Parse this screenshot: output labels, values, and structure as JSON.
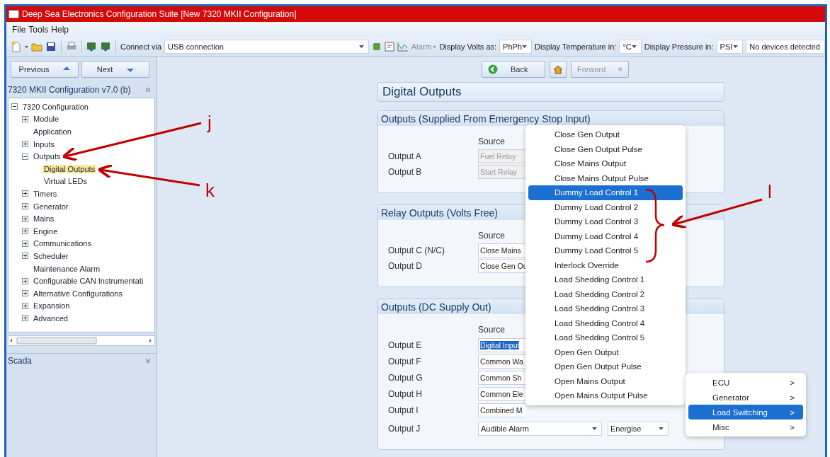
{
  "window": {
    "title": "Deep Sea Electronics Configuration Suite [New 7320 MKII Configuration]"
  },
  "menu_bar": [
    "File",
    "Tools",
    "Help"
  ],
  "toolbar": {
    "connect_label": "Connect via",
    "connection": "USB connection",
    "alarm": "Alarm",
    "volts_label": "Display Volts as:",
    "volts": "PhPh",
    "temperature_label": "Display Temperature in:",
    "temperature": "°C",
    "pressure_label": "Display Pressure in:",
    "pressure": "PSI",
    "status": "No devices detected"
  },
  "sidebar": {
    "previous": "Previous",
    "next": "Next",
    "tree_title": "7320 MKII Configuration v7.0 (b)",
    "scada": "Scada",
    "tree": [
      {
        "label": "7320 Configuration",
        "kind": "folder",
        "expanded": true,
        "selected": false,
        "children": [
          {
            "label": "Module",
            "kind": "folder",
            "expanded": false,
            "selected": false
          },
          {
            "label": "Application",
            "kind": "leaf",
            "selected": false
          },
          {
            "label": "Inputs",
            "kind": "folder",
            "expanded": false,
            "selected": false
          },
          {
            "label": "Outputs",
            "kind": "folder",
            "expanded": true,
            "selected": false,
            "children": [
              {
                "label": "Digital Outputs",
                "kind": "leaf",
                "selected": true
              },
              {
                "label": "Virtual LEDs",
                "kind": "leaf",
                "selected": false
              }
            ]
          },
          {
            "label": "Timers",
            "kind": "folder",
            "expanded": false,
            "selected": false
          },
          {
            "label": "Generator",
            "kind": "folder",
            "expanded": false,
            "selected": false
          },
          {
            "label": "Mains",
            "kind": "folder",
            "expanded": false,
            "selected": false
          },
          {
            "label": "Engine",
            "kind": "folder",
            "expanded": false,
            "selected": false
          },
          {
            "label": "Communications",
            "kind": "folder",
            "expanded": false,
            "selected": false
          },
          {
            "label": "Scheduler",
            "kind": "folder",
            "expanded": false,
            "selected": false
          },
          {
            "label": "Maintenance Alarm",
            "kind": "leaf",
            "selected": false
          },
          {
            "label": "Configurable CAN Instrumentati",
            "kind": "folder",
            "expanded": false,
            "selected": false
          },
          {
            "label": "Alternative Configurations",
            "kind": "folder",
            "expanded": false,
            "selected": false
          },
          {
            "label": "Expansion",
            "kind": "folder",
            "expanded": false,
            "selected": false
          },
          {
            "label": "Advanced",
            "kind": "folder",
            "expanded": false,
            "selected": false
          }
        ]
      }
    ]
  },
  "nav": {
    "back": "Back",
    "forward": "Forward",
    "forward_disabled": true
  },
  "page": {
    "title": "Digital Outputs",
    "sections": [
      {
        "title": "Outputs (Supplied From Emergency Stop Input)",
        "column": "Source",
        "rows": [
          {
            "label": "Output A",
            "source": "Fuel Relay",
            "disabled": true,
            "highlighted": false
          },
          {
            "label": "Output B",
            "source": "Start Relay",
            "disabled": true,
            "highlighted": false
          }
        ]
      },
      {
        "title": "Relay Outputs (Volts Free)",
        "column": "Source",
        "rows": [
          {
            "label": "Output C (N/C)",
            "source": "Close Mains",
            "disabled": false,
            "highlighted": false
          },
          {
            "label": "Output D",
            "source": "Close Gen Ou",
            "disabled": false,
            "highlighted": false
          }
        ]
      },
      {
        "title": "Outputs (DC Supply Out)",
        "column": "Source",
        "rows": [
          {
            "label": "Output E",
            "source": "Digital Input",
            "disabled": false,
            "highlighted": true
          },
          {
            "label": "Output F",
            "source": "Common Wa",
            "disabled": false,
            "highlighted": false
          },
          {
            "label": "Output G",
            "source": "Common Sh",
            "disabled": false,
            "highlighted": false
          },
          {
            "label": "Output H",
            "source": "Common Ele",
            "disabled": false,
            "highlighted": false
          },
          {
            "label": "Output I",
            "source": "Combined M",
            "disabled": false,
            "highlighted": false
          },
          {
            "label": "Output J",
            "source": "Audible Alarm",
            "polarity": "Energise",
            "disabled": false,
            "highlighted": false
          }
        ]
      }
    ]
  },
  "popup_menu": [
    {
      "label": "Close Gen Output",
      "selected": false
    },
    {
      "label": "Close Gen Output Pulse",
      "selected": false
    },
    {
      "label": "Close Mains Output",
      "selected": false
    },
    {
      "label": "Close Mains Output Pulse",
      "selected": false
    },
    {
      "label": "Dummy Load Control 1",
      "selected": true
    },
    {
      "label": "Dummy Load Control 2",
      "selected": false
    },
    {
      "label": "Dummy Load Control 3",
      "selected": false
    },
    {
      "label": "Dummy Load Control 4",
      "selected": false
    },
    {
      "label": "Dummy Load Control 5",
      "selected": false
    },
    {
      "label": "Interlock Override",
      "selected": false
    },
    {
      "label": "Load Shedding Control 1",
      "selected": false
    },
    {
      "label": "Load Shedding Control 2",
      "selected": false
    },
    {
      "label": "Load Shedding Control 3",
      "selected": false
    },
    {
      "label": "Load Shedding Control 4",
      "selected": false
    },
    {
      "label": "Load Shedding Control 5",
      "selected": false
    },
    {
      "label": "Open Gen Output",
      "selected": false
    },
    {
      "label": "Open Gen Output Pulse",
      "selected": false
    },
    {
      "label": "Open Mains Output",
      "selected": false
    },
    {
      "label": "Open Mains Output Pulse",
      "selected": false
    }
  ],
  "submenu": [
    {
      "label": "ECU",
      "chevron": ">",
      "selected": false
    },
    {
      "label": "Generator",
      "chevron": ">",
      "selected": false
    },
    {
      "label": "Load Switching",
      "chevron": ">",
      "selected": true
    },
    {
      "label": "Misc",
      "chevron": ">",
      "selected": false
    }
  ],
  "annotations": [
    "j",
    "k",
    "l"
  ]
}
